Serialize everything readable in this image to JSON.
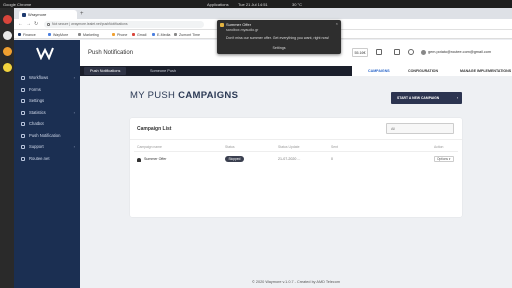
{
  "os": {
    "app_name": "Google Chrome",
    "applications_label": "Applications",
    "clock": "Tue 21 Jul 14:51",
    "temperature": "30 °C"
  },
  "browser": {
    "tab_title": "Wraymore",
    "url": "Not secure | wraymore.lealet.net/pushNotifications",
    "bookmarks": [
      "Finance",
      "WayMore",
      "Marketing",
      "Phone",
      "Gmail",
      "E-Media",
      "Zumont Time"
    ]
  },
  "notification": {
    "title": "Summer Offer",
    "site": "sandbox.myaudio.gr",
    "body": "Don't miss our summer offer. Get everything you want, right now!",
    "settings": "Settings"
  },
  "sidebar": {
    "items": [
      {
        "label": "Workflows",
        "chevron": true
      },
      {
        "label": "Forms",
        "chevron": false
      },
      {
        "label": "Settings",
        "chevron": false
      },
      {
        "label": "Statistics",
        "chevron": true
      },
      {
        "label": "Chatbot",
        "chevron": false
      },
      {
        "label": "Push Notification",
        "chevron": false
      },
      {
        "label": "Support",
        "chevron": true
      },
      {
        "label": "Routee.net",
        "chevron": false
      }
    ]
  },
  "header": {
    "title": "Push Notification",
    "balance": "55.16€",
    "email": "gem.potato@routee.com@gmail.com"
  },
  "subnav": {
    "active": "Push Notifications",
    "second": "Someone Push"
  },
  "rightnav": {
    "campaigns": "CAMPAIGNS",
    "configuration": "CONFIGURATION",
    "implementations": "MANAGE IMPLEMENTATIONS"
  },
  "page": {
    "heading_light": "MY PUSH",
    "heading_bold": "CAMPAIGNS",
    "new_button": "START A NEW CAMPAIGN"
  },
  "campaigns": {
    "card_title": "Campaign List",
    "filter_value": "All",
    "columns": [
      "Campaign name",
      "Status",
      "Status Update",
      "Sent",
      "Action"
    ],
    "rows": [
      {
        "name": "Summer Offer",
        "status": "Stopped",
        "updated": "21-07-2020 ...",
        "sent": "0",
        "action": "Options"
      }
    ]
  },
  "footer": {
    "text": "© 2020 Waymore v.1.0.7 - Created by AMD Telecom"
  }
}
